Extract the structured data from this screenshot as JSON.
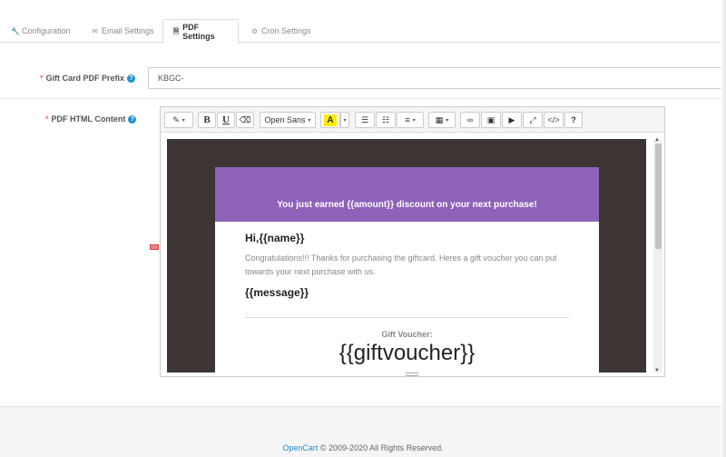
{
  "tabs": [
    {
      "label": "Configuration",
      "icon": "wrench-icon",
      "glyph": "🔧"
    },
    {
      "label": "Email Settings",
      "icon": "envelope-icon",
      "glyph": "✉"
    },
    {
      "label": "PDF Settings",
      "icon": "file-icon",
      "glyph": "🗎"
    },
    {
      "label": "Cron Settings",
      "icon": "cogs-icon",
      "glyph": "⚙"
    }
  ],
  "form": {
    "prefix_label": "Gift Card PDF Prefix",
    "prefix_value": "KBGC-",
    "content_label": "PDF HTML Content",
    "required_mark": "*",
    "help_glyph": "?"
  },
  "toolbar": {
    "style_glyph": "✎",
    "bold": "B",
    "underline": "U",
    "eraser_glyph": "⌫",
    "font_name": "Open Sans",
    "color_letter": "A",
    "ul_glyph": "☰",
    "ol_glyph": "☷",
    "align_glyph": "≡",
    "table_glyph": "▦",
    "link_glyph": "∞",
    "picture_glyph": "▣",
    "video_glyph": "▶",
    "fullscreen_glyph": "⤢",
    "code_glyph": "</>",
    "help_glyph": "?",
    "caret": "▾"
  },
  "template": {
    "banner": "You just earned {{amount}} discount on your next purchase!",
    "greeting": "Hi,{{name}}",
    "congrats": "Congratulations!!! Thanks for purchasing the giftcard. Heres a gift voucher you can put towards your next purchase with us.",
    "message": "{{message}}",
    "voucher_label": "Gift Voucher:",
    "voucher_code": "{{giftvoucher}}"
  },
  "footer": {
    "brand": "OpenCart",
    "text": " © 2009-2020 All Rights Reserved."
  },
  "colors": {
    "banner": "#8e62b9",
    "canvas": "#3d3533",
    "link": "#1e91cf",
    "required": "#f56b6b"
  }
}
